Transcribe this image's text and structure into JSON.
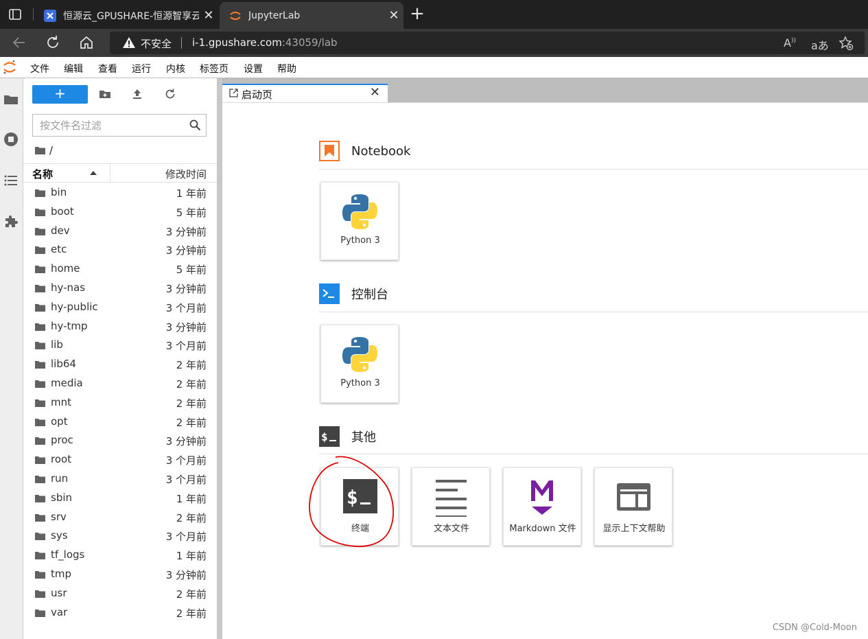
{
  "browser": {
    "tabs": [
      {
        "title": "恒源云_GPUSHARE-恒源智享云",
        "active": false
      },
      {
        "title": "JupyterLab",
        "active": true
      }
    ],
    "address": {
      "security_label": "不安全",
      "host": "i-1.gpushare.com",
      "rest": ":43059/lab"
    }
  },
  "menubar": {
    "items": [
      "文件",
      "编辑",
      "查看",
      "运行",
      "内核",
      "标签页",
      "设置",
      "帮助"
    ]
  },
  "filebrowser": {
    "new_label": "+",
    "filter_placeholder": "按文件名过滤",
    "breadcrumb": "/",
    "header": {
      "name": "名称",
      "modified": "修改时间"
    },
    "items": [
      {
        "name": "bin",
        "modified": "1 年前"
      },
      {
        "name": "boot",
        "modified": "5 年前"
      },
      {
        "name": "dev",
        "modified": "3 分钟前"
      },
      {
        "name": "etc",
        "modified": "3 分钟前"
      },
      {
        "name": "home",
        "modified": "5 年前"
      },
      {
        "name": "hy-nas",
        "modified": "3 分钟前"
      },
      {
        "name": "hy-public",
        "modified": "3 个月前"
      },
      {
        "name": "hy-tmp",
        "modified": "3 分钟前"
      },
      {
        "name": "lib",
        "modified": "3 个月前"
      },
      {
        "name": "lib64",
        "modified": "2 年前"
      },
      {
        "name": "media",
        "modified": "2 年前"
      },
      {
        "name": "mnt",
        "modified": "2 年前"
      },
      {
        "name": "opt",
        "modified": "2 年前"
      },
      {
        "name": "proc",
        "modified": "3 分钟前"
      },
      {
        "name": "root",
        "modified": "3 个月前"
      },
      {
        "name": "run",
        "modified": "3 个月前"
      },
      {
        "name": "sbin",
        "modified": "1 年前"
      },
      {
        "name": "srv",
        "modified": "2 年前"
      },
      {
        "name": "sys",
        "modified": "3 个月前"
      },
      {
        "name": "tf_logs",
        "modified": "1 年前"
      },
      {
        "name": "tmp",
        "modified": "3 分钟前"
      },
      {
        "name": "usr",
        "modified": "2 年前"
      },
      {
        "name": "var",
        "modified": "2 年前"
      }
    ]
  },
  "launcher": {
    "tab_label": "启动页",
    "sections": {
      "notebook": {
        "title": "Notebook",
        "cards": [
          "Python 3"
        ]
      },
      "console": {
        "title": "控制台",
        "cards": [
          "Python 3"
        ]
      },
      "other": {
        "title": "其他",
        "cards": [
          "终端",
          "文本文件",
          "Markdown 文件",
          "显示上下文帮助"
        ]
      }
    }
  },
  "watermark": "CSDN @Cold-Moon",
  "colors": {
    "accent": "#1e88e5",
    "jupyter_orange": "#f37726",
    "annotation": "#e00000"
  }
}
